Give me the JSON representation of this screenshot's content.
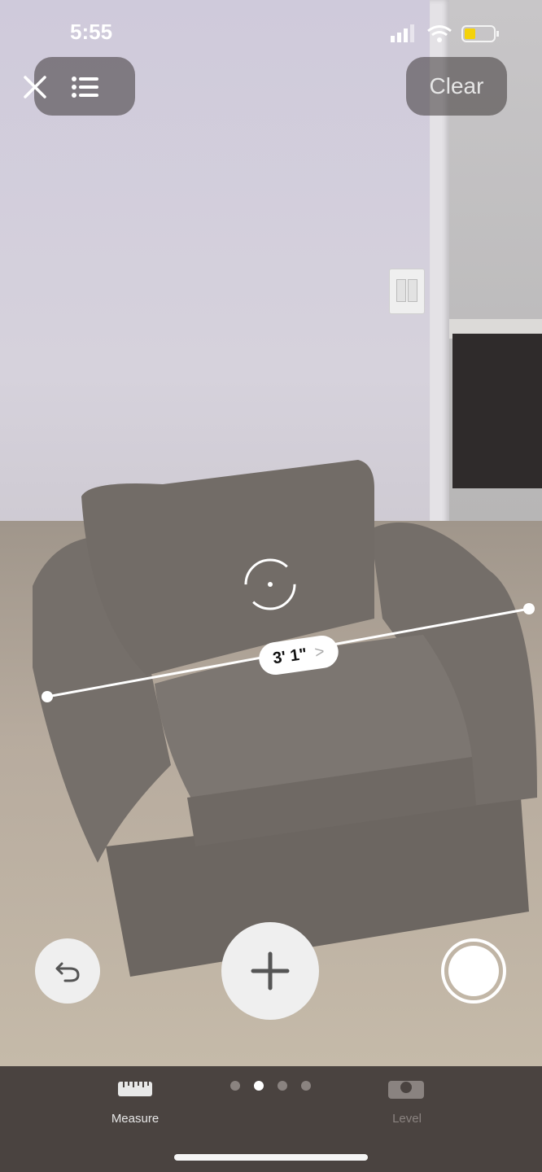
{
  "status_bar": {
    "time": "5:55"
  },
  "top_bar": {
    "clear_label": "Clear",
    "close_icon": "close-icon",
    "list_icon": "list-icon"
  },
  "measurement": {
    "value": "3' 1\"",
    "chevron": ">"
  },
  "controls": {
    "undo_icon": "undo-icon",
    "add_icon": "plus-icon",
    "capture_icon": "shutter-icon"
  },
  "tabs": [
    {
      "label": "Measure",
      "icon": "ruler-icon",
      "active": true
    },
    {
      "label": "Level",
      "icon": "level-icon",
      "active": false
    }
  ],
  "pager": {
    "count": 4,
    "active_index": 1
  },
  "colors": {
    "accent": "#ffffff",
    "pill_bg": "#3c3737",
    "battery": "#f4d20a"
  }
}
